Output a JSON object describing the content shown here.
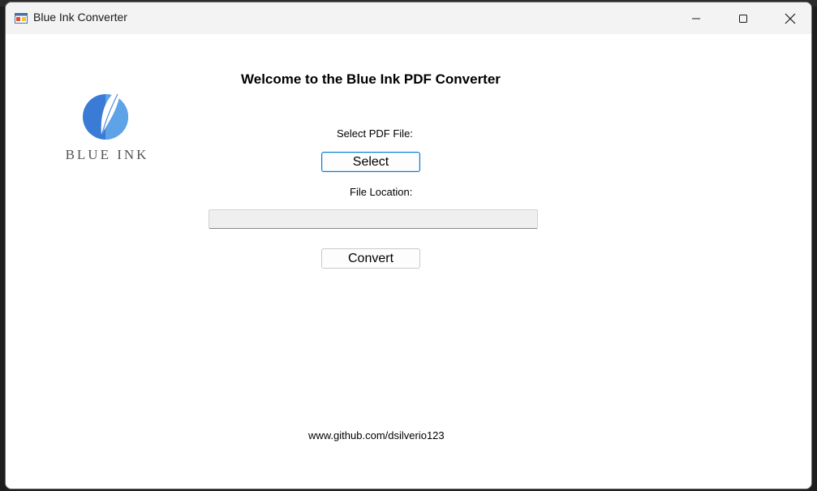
{
  "window": {
    "title": "Blue Ink Converter",
    "icons": {
      "app": "app-window-icon",
      "minimize": "minimize-icon",
      "maximize": "maximize-icon",
      "close": "close-icon"
    }
  },
  "main": {
    "heading": "Welcome to the Blue Ink PDF Converter",
    "logo_text": "BLUE INK",
    "logo_color": "#3a7bd5",
    "select_label": "Select PDF File:",
    "select_button": "Select",
    "location_label": "File Location:",
    "file_location_value": "",
    "convert_button": "Convert",
    "footer_link": "www.github.com/dsilverio123"
  }
}
